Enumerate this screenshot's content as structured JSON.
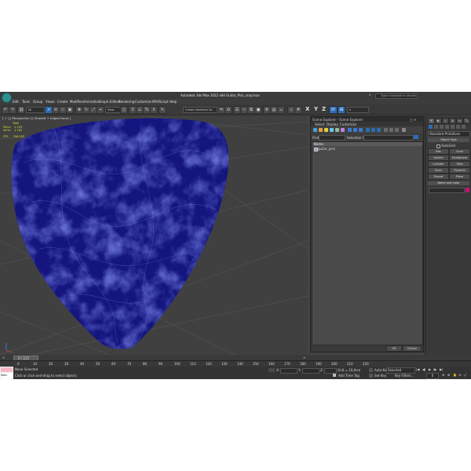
{
  "window": {
    "title": "Autodesk 3ds Max 2022 x64     Guitar_Pick_vray.max",
    "search_placeholder": "Type a keyword or phrase"
  },
  "menu": [
    "Edit",
    "Tools",
    "Group",
    "Views",
    "Create",
    "Modifiers",
    "Animation",
    "Graph Editors",
    "Rendering",
    "Customize",
    "MAXScript",
    "Help"
  ],
  "toolbar": {
    "filter": "All",
    "view_dropdown": "View",
    "selection_set": "Create Selection Se",
    "axis_labels": [
      "X",
      "Y",
      "Z",
      "XY"
    ]
  },
  "viewport": {
    "label": "[ + ] [ Perspective ] [ Shaded + Edged Faces ]",
    "stats": {
      "header": "Total",
      "polys_label": "Polys:",
      "polys_value": "2 192",
      "verts_label": "Verts:",
      "verts_value": "1 162",
      "fps_label": "FPS:",
      "fps_value": "296.035"
    },
    "object_color": "#1a1aa0"
  },
  "scene_explorer": {
    "title": "Scene Explorer - Scene Explorer",
    "tabs": [
      "Select",
      "Display",
      "Customize"
    ],
    "find_label": "Find:",
    "selection_set_label": "Selection Set:",
    "column_header": "Name",
    "items": [
      "guitar_pick"
    ],
    "ok_label": "OK",
    "cancel_label": "Cancel"
  },
  "command_panel": {
    "dropdown": "Standard Primitives",
    "object_type_header": "Object Type",
    "autogrid_label": "AutoGrid",
    "buttons": [
      "Box",
      "Cone",
      "Sphere",
      "GeoSphere",
      "Cylinder",
      "Tube",
      "Torus",
      "Pyramid",
      "Teapot",
      "Plane"
    ],
    "name_color_header": "Name and Color",
    "swatch_color": "#c0157a"
  },
  "timeline": {
    "slider_label": "0 / 225",
    "ticks": [
      "0",
      "10",
      "20",
      "30",
      "40",
      "50",
      "60",
      "70",
      "80",
      "90",
      "100",
      "110",
      "120",
      "130",
      "140",
      "150",
      "160",
      "170",
      "180",
      "190",
      "200",
      "210",
      "220"
    ]
  },
  "status": {
    "none_selected": "None Selected",
    "prompt": "Click or click-and-drag to select objects",
    "x_label": "X:",
    "y_label": "Y:",
    "z_label": "Z:",
    "grid": "Grid = 10,0cm",
    "add_time_tag": "Add Time Tag",
    "auto_key": "Auto Key",
    "selected": "Selected",
    "set_key": "Set Key",
    "key_filters": "Key Filters...",
    "frame": "0",
    "script_label": "Welc"
  }
}
